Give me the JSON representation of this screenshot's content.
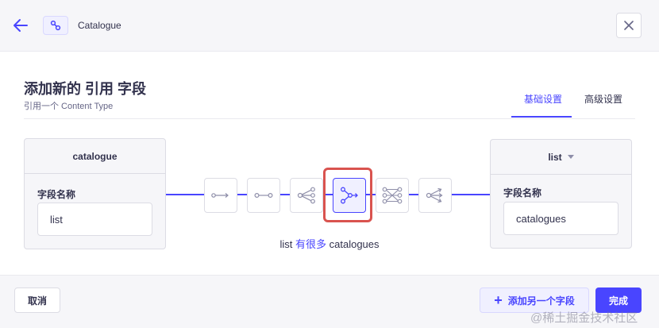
{
  "header": {
    "back_icon": "arrow-left-icon",
    "breadcrumb_icon": "relation-link-icon",
    "title": "Catalogue",
    "close_icon": "close-icon"
  },
  "modal": {
    "title": "添加新的 引用 字段",
    "subtitle": "引用一个 Content Type",
    "tabs": [
      {
        "label": "基础设置",
        "active": true
      },
      {
        "label": "高级设置",
        "active": false
      }
    ]
  },
  "left_card": {
    "title": "catalogue",
    "field_label": "字段名称",
    "field_value": "list"
  },
  "right_card": {
    "title": "list",
    "dropdown_icon": "caret-down-icon",
    "field_label": "字段名称",
    "field_value": "catalogues"
  },
  "relations": [
    {
      "icon": "one-way-icon",
      "selected": false
    },
    {
      "icon": "one-to-one-icon",
      "selected": false
    },
    {
      "icon": "one-to-many-icon",
      "selected": false
    },
    {
      "icon": "many-to-one-icon",
      "selected": true
    },
    {
      "icon": "many-to-many-icon",
      "selected": false
    },
    {
      "icon": "many-way-icon",
      "selected": false
    }
  ],
  "relation_text": {
    "left": "list",
    "verb": "有很多",
    "right": "catalogues"
  },
  "footer": {
    "cancel_label": "取消",
    "add_label": "添加另一个字段",
    "done_label": "完成"
  },
  "watermark": "@稀土掘金技术社区",
  "colors": {
    "accent": "#4945ff",
    "highlight": "#d9534f"
  }
}
